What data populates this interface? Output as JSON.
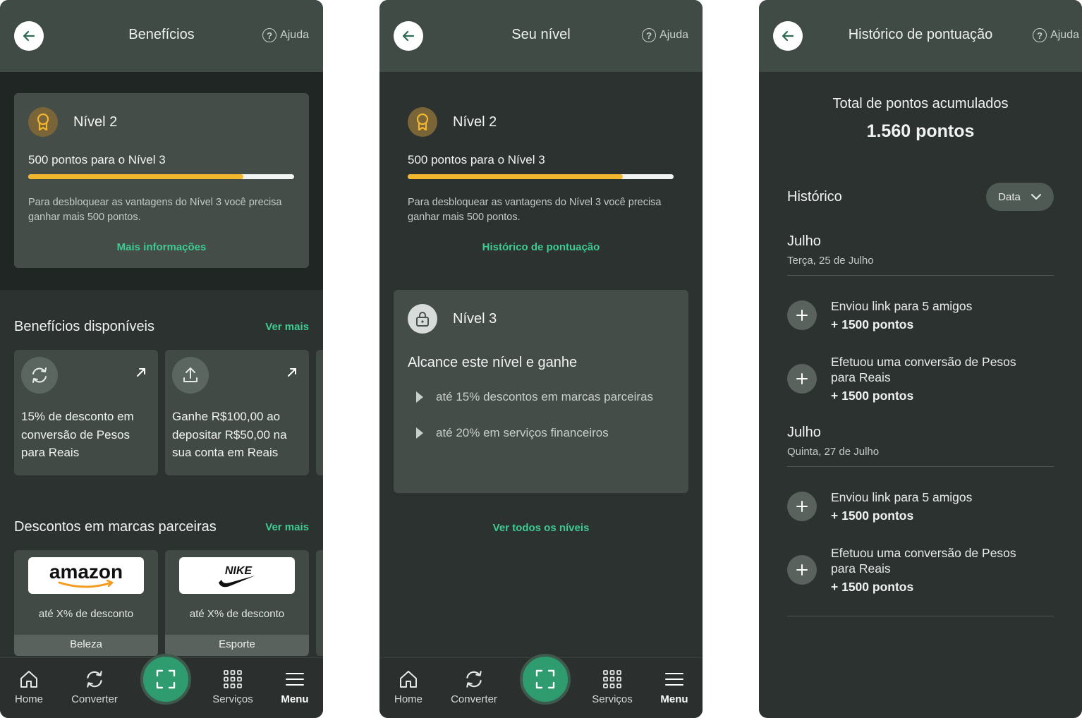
{
  "colors": {
    "accent": "#3ecb93",
    "progress": "#f2b72e",
    "background": "#2c322f",
    "header": "#414b46"
  },
  "screen1": {
    "title": "Benefícios",
    "help": "Ajuda",
    "level": {
      "name": "Nível 2",
      "progress_text": "500 pontos para o Nível 3",
      "progress": 0.81,
      "description": "Para desbloquear as vantagens do Nível 3 você precisa ganhar mais 500 pontos.",
      "link": "Mais informações"
    },
    "benefits": {
      "title": "Benefícios disponíveis",
      "see_more": "Ver mais",
      "items": [
        {
          "icon": "refresh-icon",
          "text": "15% de desconto em conversão de Pesos para Reais"
        },
        {
          "icon": "upload-icon",
          "text": "Ganhe R$100,00 ao depositar R$50,00 na sua conta em Reais"
        }
      ]
    },
    "brands": {
      "title": "Descontos em marcas parceiras",
      "see_more": "Ver mais",
      "items": [
        {
          "logo": "amazon",
          "discount": "até X% de desconto",
          "category": "Beleza"
        },
        {
          "logo": "NIKE",
          "discount": "até X% de desconto",
          "category": "Esporte"
        }
      ]
    }
  },
  "screen2": {
    "title": "Seu nível",
    "help": "Ajuda",
    "level": {
      "name": "Nível 2",
      "progress_text": "500 pontos para o Nível 3",
      "progress": 0.81,
      "description": "Para desbloquear as vantagens do Nível 3 você precisa ganhar mais 500 pontos.",
      "link": "Histórico de pontuação"
    },
    "next_level": {
      "name": "Nível 3",
      "heading": "Alcance este nível e ganhe",
      "perks": [
        "até 15% descontos em marcas parceiras",
        "até 20% em serviços financeiros"
      ]
    },
    "all_levels_link": "Ver todos os níveis"
  },
  "screen3": {
    "title": "Histórico de pontuação",
    "help": "Ajuda",
    "total_label": "Total de pontos acumulados",
    "total_value": "1.560 pontos",
    "history_title": "Histórico",
    "filter_label": "Data",
    "groups": [
      {
        "month": "Julho",
        "day": "Terça, 25 de Julho",
        "entries": [
          {
            "text": "Enviou link para 5 amigos",
            "points": "+ 1500 pontos"
          },
          {
            "text": "Efetuou uma conversão de Pesos para Reais",
            "points": "+ 1500 pontos"
          }
        ]
      },
      {
        "month": "Julho",
        "day": "Quinta, 27 de Julho",
        "entries": [
          {
            "text": "Enviou link para 5 amigos",
            "points": "+ 1500 pontos"
          },
          {
            "text": "Efetuou uma conversão de Pesos para Reais",
            "points": "+ 1500 pontos"
          }
        ]
      }
    ]
  },
  "nav": {
    "home": "Home",
    "converter": "Converter",
    "services": "Serviços",
    "menu": "Menu"
  }
}
